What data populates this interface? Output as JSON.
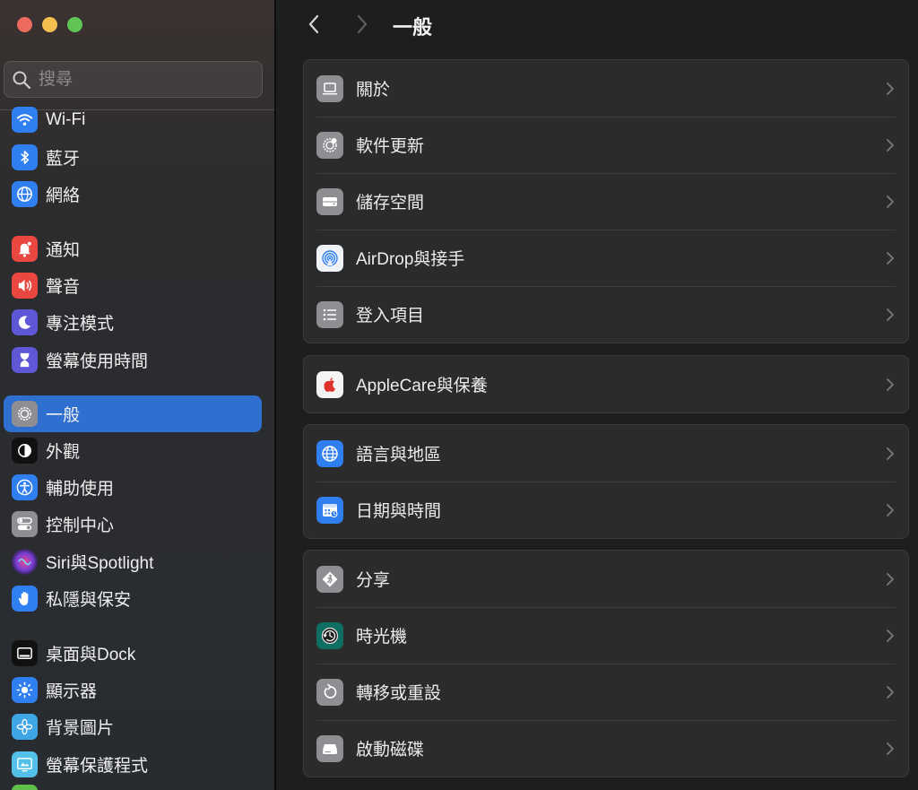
{
  "search": {
    "placeholder": "搜尋"
  },
  "sidebar": {
    "items": [
      {
        "label": "Wi-Fi"
      },
      {
        "label": "藍牙"
      },
      {
        "label": "網絡"
      },
      {
        "label": "通知"
      },
      {
        "label": "聲音"
      },
      {
        "label": "專注模式"
      },
      {
        "label": "螢幕使用時間"
      },
      {
        "label": "一般"
      },
      {
        "label": "外觀"
      },
      {
        "label": "輔助使用"
      },
      {
        "label": "控制中心"
      },
      {
        "label": "Siri與Spotlight"
      },
      {
        "label": "私隱與保安"
      },
      {
        "label": "桌面與Dock"
      },
      {
        "label": "顯示器"
      },
      {
        "label": "背景圖片"
      },
      {
        "label": "螢幕保護程式"
      }
    ]
  },
  "main": {
    "title": "一般",
    "groups": [
      {
        "rows": [
          {
            "label": "關於"
          },
          {
            "label": "軟件更新"
          },
          {
            "label": "儲存空間"
          },
          {
            "label": "AirDrop與接手"
          },
          {
            "label": "登入項目"
          }
        ]
      },
      {
        "rows": [
          {
            "label": "AppleCare與保養"
          }
        ]
      },
      {
        "rows": [
          {
            "label": "語言與地區"
          },
          {
            "label": "日期與時間"
          }
        ]
      },
      {
        "rows": [
          {
            "label": "分享"
          },
          {
            "label": "時光機"
          },
          {
            "label": "轉移或重設"
          },
          {
            "label": "啟動磁碟"
          }
        ]
      }
    ]
  }
}
